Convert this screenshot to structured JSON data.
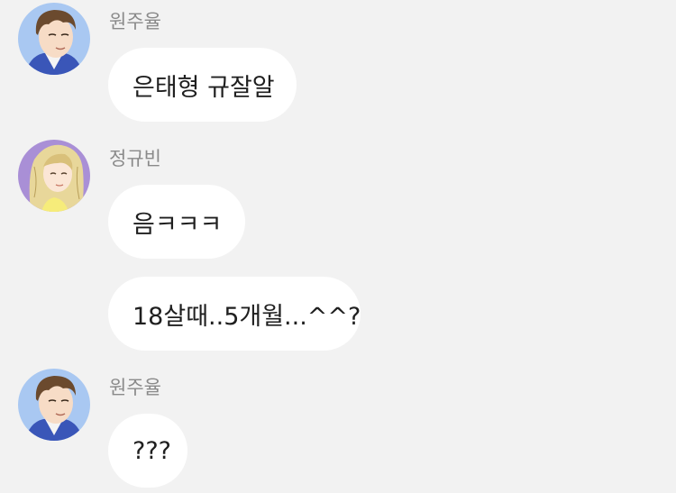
{
  "messages": [
    {
      "sender": "원주율",
      "avatar": "male-character-avatar",
      "bubbles": [
        "은태형 규잘알"
      ]
    },
    {
      "sender": "정규빈",
      "avatar": "female-character-avatar",
      "bubbles": [
        "음ㅋㅋㅋ",
        "18살때..5개월...^^?"
      ]
    },
    {
      "sender": "원주율",
      "avatar": "male-character-avatar",
      "bubbles": [
        "???"
      ]
    }
  ],
  "colors": {
    "background": "#f2f2f2",
    "bubble": "#ffffff",
    "sender_text": "#8a8a8a",
    "message_text": "#1f1f1f",
    "male_avatar_bg": "#a9c8f2",
    "female_avatar_bg": "#a98fd6"
  }
}
